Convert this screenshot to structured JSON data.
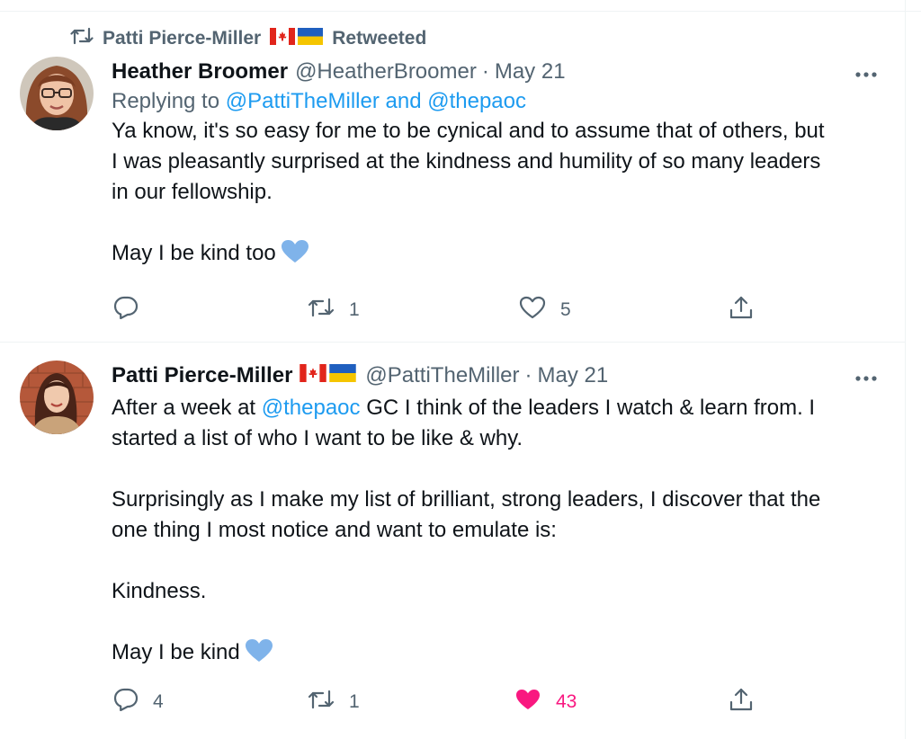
{
  "tweet1": {
    "retweet_user": "Patti Pierce-Miller",
    "retweet_label": "Retweeted",
    "author_name": "Heather Broomer",
    "handle": "@HeatherBroomer",
    "dot": "·",
    "date": "May 21",
    "replying_prefix": "Replying to",
    "reply_mention1": "@PattiTheMiller",
    "reply_and": "and",
    "reply_mention2": "@thepaoc",
    "body_line1": "Ya know, it's so easy for me to be cynical and to assume that of others, but",
    "body_line2": "I was pleasantly surprised at the kindness and humility of so many leaders",
    "body_line3": "in our fellowship.",
    "body_line4": "May I be kind too",
    "reply_count": "",
    "retweet_count": "1",
    "like_count": "5"
  },
  "tweet2": {
    "author_name": "Patti Pierce-Miller",
    "handle": "@PattiTheMiller",
    "dot": "·",
    "date": "May 21",
    "p1_pre": "After a week at",
    "p1_mention": "@thepaoc",
    "p1_post": "GC I think of the leaders I watch & learn from. I",
    "p1_line2": "started a list of who I want to be like & why.",
    "p2_line1": "Surprisingly as I make my list of brilliant, strong leaders, I discover that the",
    "p2_line2": "one thing I most notice and want to emulate is:",
    "p3": "Kindness.",
    "p4": "May I be kind",
    "reply_count": "4",
    "retweet_count": "1",
    "like_count": "43"
  },
  "colors": {
    "link": "#1d9bf0",
    "muted": "#536471",
    "like_active": "#f91880",
    "heart_emoji": "#7fb3ea"
  },
  "icons": [
    "retweet-icon",
    "canada-flag-icon",
    "ukraine-flag-icon",
    "more-icon",
    "reply-icon",
    "like-icon",
    "share-icon",
    "blue-heart-emoji"
  ]
}
